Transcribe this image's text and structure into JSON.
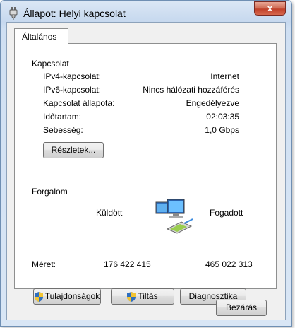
{
  "window": {
    "title": "Állapot: Helyi kapcsolat",
    "close_glyph": "x"
  },
  "tabs": [
    {
      "label": "Általános"
    }
  ],
  "connection": {
    "group_title": "Kapcsolat",
    "rows": [
      {
        "label": "IPv4-kapcsolat:",
        "value": "Internet"
      },
      {
        "label": "IPv6-kapcsolat:",
        "value": "Nincs hálózati hozzáférés"
      },
      {
        "label": "Kapcsolat állapota:",
        "value": "Engedélyezve"
      },
      {
        "label": "Időtartam:",
        "value": "02:03:35"
      },
      {
        "label": "Sebesség:",
        "value": "1,0 Gbps"
      }
    ],
    "details_button": "Részletek..."
  },
  "activity": {
    "group_title": "Forgalom",
    "sent_label": "Küldött",
    "received_label": "Fogadott",
    "size_label": "Méret:",
    "sent_value": "176 422 415",
    "received_value": "465 022 313",
    "icon": "network-computers-icon"
  },
  "buttons": {
    "properties": "Tulajdonságok",
    "disable": "Tiltás",
    "diagnose": "Diagnosztika",
    "close": "Bezárás"
  },
  "colors": {
    "title_bar": "#c6d8ee",
    "close_button": "#c1412a",
    "shield_blue": "#2f6fbf",
    "shield_yellow": "#f2c433"
  }
}
